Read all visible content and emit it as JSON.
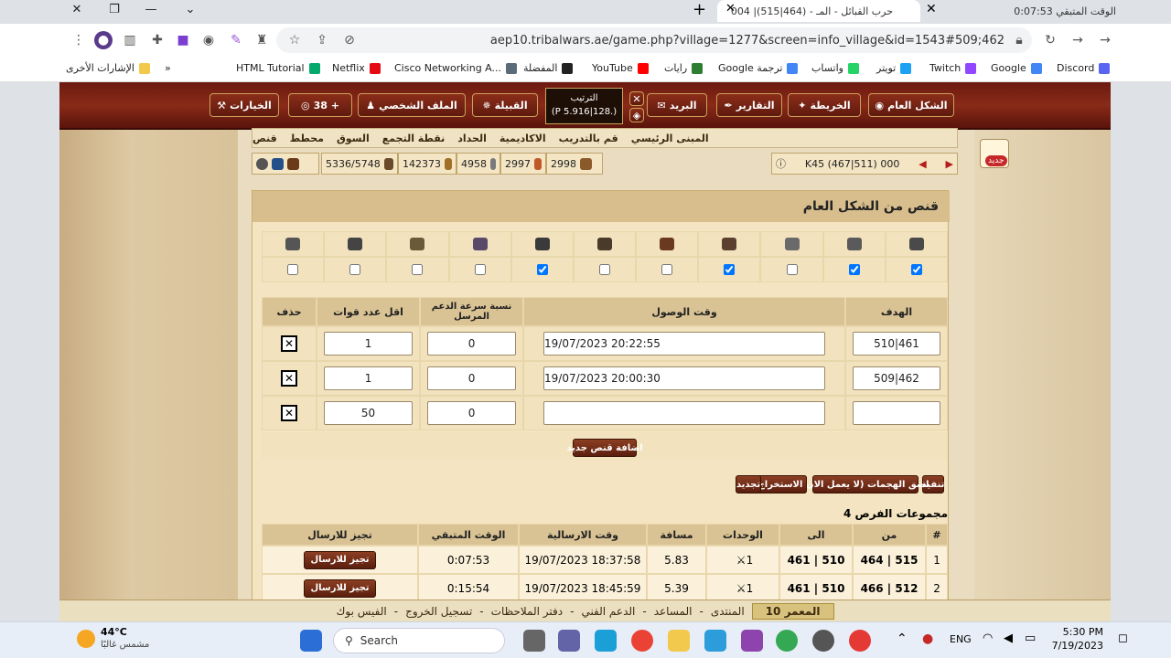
{
  "browser": {
    "tabs": [
      {
        "title": "الوقت المتبقي 0:07:53",
        "active": false
      },
      {
        "title": "004 |(515|464) - حرب القبائل - المـ",
        "active": true
      }
    ],
    "url": "aep10.tribalwars.ae/game.php?village=1277&screen=info_village&id=1543#509;462",
    "bookmarks": [
      "Discord",
      "Google",
      "Twitch",
      "تويتر",
      "واتساب",
      "Google ترجمة",
      "رايات",
      "YouTube",
      "المفضلة",
      "Cisco Networking A...",
      "Netflix",
      "HTML Tutorial",
      "»",
      "الإشارات الأخرى"
    ]
  },
  "nav": {
    "buttons": [
      "الشكل العام",
      "الخريطة",
      "التقارير",
      "البريد",
      "القبيلة",
      "الملف الشخصي",
      "38 +",
      "الخيارات"
    ],
    "rank_label": "الترتيب",
    "rank_value": "(P 5.916|128.)"
  },
  "menu": {
    "items": [
      "المبنى الرئيسي",
      "قم بالتدريب",
      "الاكاديمية",
      "الحداد",
      "نقطة التجمع",
      "السوق",
      "محطط",
      "قنص"
    ],
    "new_badge": "جديد"
  },
  "village": {
    "coords": "K45 (467|511) 000"
  },
  "resources": {
    "wood": "2998",
    "clay": "2997",
    "iron": "4958",
    "points": "142373",
    "pop": "5336/5748"
  },
  "panel": {
    "title": "قنص من الشكل العام",
    "units_checked": [
      true,
      true,
      false,
      true,
      false,
      false,
      true,
      false,
      false,
      false,
      false
    ],
    "table_headers": [
      "الهدف",
      "وقت الوصول",
      "نسبة سرعة الدعم المرسل",
      "اقل عدد قوات",
      "حذف"
    ],
    "rows": [
      {
        "target": "461|510",
        "arrival": "20:22:55 19/07/2023",
        "speed": "0",
        "min": "1"
      },
      {
        "target": "462|509",
        "arrival": "20:00:30 19/07/2023",
        "speed": "0",
        "min": "1"
      },
      {
        "target": "",
        "arrival": "",
        "speed": "0",
        "min": "50"
      }
    ],
    "add_button": "اضافة قنص جديد",
    "actions": [
      "تنفيذ",
      "لصق الهجمات (لا يعمل الان)",
      "الاستخراج",
      "تجديد"
    ],
    "groups_title": "4 مجموعات الفرص",
    "groups_headers": [
      "#",
      "من",
      "الى",
      "الوحدات",
      "مسافة",
      "وقت الارسالية",
      "الوقت المتبقي",
      "تجيز للارسال"
    ],
    "groups": [
      {
        "n": "1",
        "from": "515 | 464",
        "to": "510 | 461",
        "units": "1",
        "dist": "5.83",
        "send": "18:37:58 19/07/2023",
        "remain": "0:07:53",
        "btn": "تجيز للارسال"
      },
      {
        "n": "2",
        "from": "512 | 466",
        "to": "510 | 461",
        "units": "1",
        "dist": "5.39",
        "send": "18:45:59 19/07/2023",
        "remain": "0:15:54",
        "btn": "تجيز للارسال"
      }
    ]
  },
  "footer": {
    "items": [
      "المعمر 10",
      "المنتدى",
      "المساعد",
      "الدعم الفني",
      "دفتر الملاحظات",
      "تسجيل الخروج",
      "الفيس بوك"
    ]
  },
  "taskbar": {
    "temp": "44°C",
    "weather": "مشمس غالبًا",
    "search": "Search",
    "lang": "ENG",
    "time": "5:30 PM",
    "date": "7/19/2023"
  }
}
